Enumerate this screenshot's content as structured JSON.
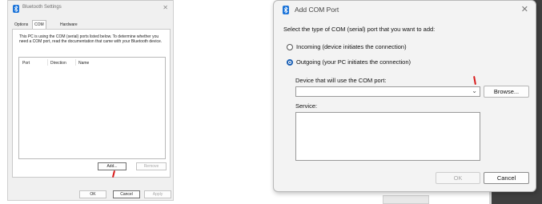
{
  "bluetooth_settings": {
    "title": "Bluetooth Settings",
    "close_glyph": "✕",
    "icon": "bluetooth-icon",
    "tabs": [
      "Options",
      "COM Ports",
      "Hardware"
    ],
    "active_tab": "COM Ports",
    "description": "This PC is using the COM (serial) ports listed below. To determine whether you need a COM port, read the documentation that came with your Bluetooth device.",
    "columns": [
      "Port",
      "Direction",
      "Name"
    ],
    "rows": [],
    "add_label": "Add...",
    "remove_label": "Remove",
    "ok_label": "OK",
    "cancel_label": "Cancel",
    "apply_label": "Apply"
  },
  "add_com_port": {
    "title": "Add COM Port",
    "close_glyph": "✕",
    "icon": "bluetooth-icon",
    "prompt": "Select the type of COM (serial) port that you want to add:",
    "options": [
      {
        "label": "Incoming (device initiates the connection)",
        "checked": false
      },
      {
        "label": "Outgoing (your PC initiates the connection)",
        "checked": true
      }
    ],
    "device_label": "Device that will use the COM port:",
    "device_value": "",
    "browse_label": "Browse...",
    "service_label": "Service:",
    "service_value": "",
    "ok_label": "OK",
    "cancel_label": "Cancel"
  },
  "colors": {
    "accent": "#1a5fb4",
    "bluetooth_icon": "#1a73d9",
    "annotation_mark": "#d81a1a"
  }
}
